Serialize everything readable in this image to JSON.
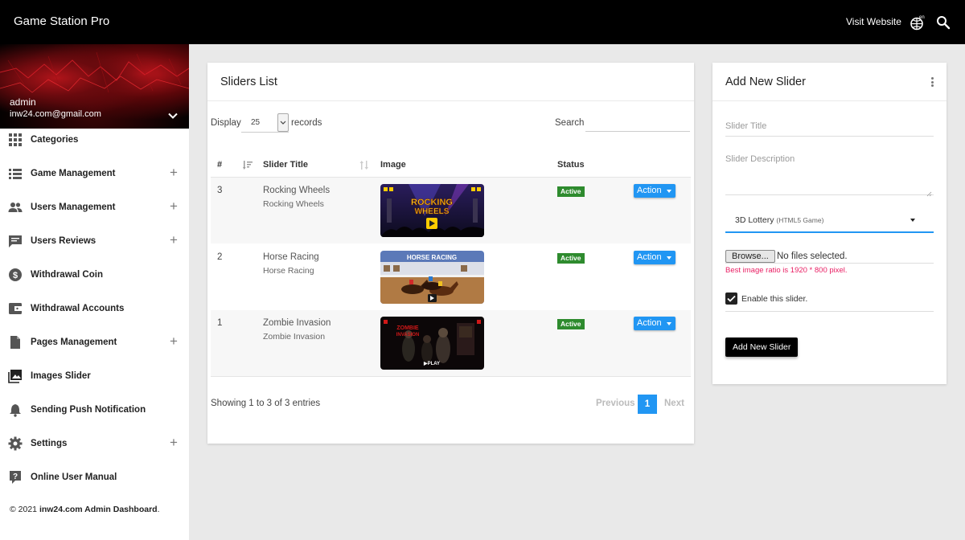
{
  "header": {
    "brand": "Game Station Pro",
    "visit_website": "Visit Website",
    "language": "en",
    "globe_icon": "globe-icon",
    "search_icon": "search-icon"
  },
  "sidebar": {
    "user_name": "admin",
    "user_email": "inw24.com@gmail.com",
    "items": [
      {
        "label": "Categories",
        "icon": "grid-icon",
        "expandable": false
      },
      {
        "label": "Game Management",
        "icon": "list-icon",
        "expandable": true
      },
      {
        "label": "Users Management",
        "icon": "people-icon",
        "expandable": true
      },
      {
        "label": "Users Reviews",
        "icon": "comment-icon",
        "expandable": true
      },
      {
        "label": "Withdrawal Coin",
        "icon": "dollar-icon",
        "expandable": false
      },
      {
        "label": "Withdrawal Accounts",
        "icon": "wallet-icon",
        "expandable": false
      },
      {
        "label": "Pages Management",
        "icon": "page-icon",
        "expandable": true
      },
      {
        "label": "Images Slider",
        "icon": "image-icon",
        "expandable": false
      },
      {
        "label": "Sending Push Notification",
        "icon": "bell-icon",
        "expandable": false
      },
      {
        "label": "Settings",
        "icon": "gear-icon",
        "expandable": true
      },
      {
        "label": "Online User Manual",
        "icon": "help-icon",
        "expandable": false
      }
    ],
    "footer_prefix": "© 2021 ",
    "footer_brand": "inw24.com Admin Dashboard",
    "footer_suffix": "."
  },
  "sliders_list": {
    "title": "Sliders List",
    "display_label": "Display",
    "display_value": "25",
    "records_label": "records",
    "search_label": "Search",
    "columns": {
      "num": "#",
      "title": "Slider Title",
      "image": "Image",
      "status": "Status"
    },
    "rows": [
      {
        "num": "3",
        "title": "Rocking Wheels",
        "subtitle": "Rocking Wheels",
        "status": "Active",
        "action": "Action",
        "thumb_text": "ROCKING WHEELS"
      },
      {
        "num": "2",
        "title": "Horse Racing",
        "subtitle": "Horse Racing",
        "status": "Active",
        "action": "Action",
        "thumb_text": "HORSE RACING"
      },
      {
        "num": "1",
        "title": "Zombie Invasion",
        "subtitle": "Zombie Invasion",
        "status": "Active",
        "action": "Action",
        "thumb_text": "ZOMBIE INVASION"
      }
    ],
    "showing": "Showing 1 to 3 of 3 entries",
    "previous": "Previous",
    "page": "1",
    "next": "Next"
  },
  "add_slider": {
    "title": "Add New Slider",
    "slider_title_placeholder": "Slider Title",
    "slider_description_placeholder": "Slider Description",
    "game_select_value": "3D Lottery",
    "game_select_type": "(HTML5 Game)",
    "browse_label": "Browse...",
    "file_status": "No files selected.",
    "ratio_hint": "Best image ratio is 1920 * 800 pixel.",
    "enable_label": "Enable this slider.",
    "enable_checked": true,
    "submit_label": "Add New Slider"
  },
  "colors": {
    "accent": "#2196f3",
    "active_badge": "#2e8b2e",
    "hint": "#e91e63",
    "topbar": "#000000"
  }
}
